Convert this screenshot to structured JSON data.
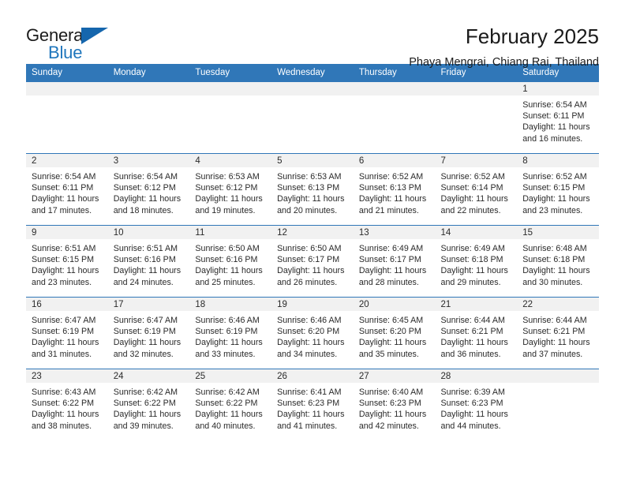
{
  "brand": {
    "name_top": "General",
    "name_bottom": "Blue",
    "triangle_color": "#1566ad",
    "blue_text_color": "#1f76bc"
  },
  "header": {
    "title": "February 2025",
    "subtitle": "Phaya Mengrai, Chiang Rai, Thailand",
    "header_bg": "#3077b8",
    "daynum_bg": "#f1f1f1"
  },
  "weekday_headers": [
    "Sunday",
    "Monday",
    "Tuesday",
    "Wednesday",
    "Thursday",
    "Friday",
    "Saturday"
  ],
  "labels": {
    "sunrise": "Sunrise:",
    "sunset": "Sunset:",
    "daylight": "Daylight:"
  },
  "weeks": [
    [
      {
        "day": "",
        "empty": true
      },
      {
        "day": "",
        "empty": true
      },
      {
        "day": "",
        "empty": true
      },
      {
        "day": "",
        "empty": true
      },
      {
        "day": "",
        "empty": true
      },
      {
        "day": "",
        "empty": true
      },
      {
        "day": "1",
        "sunrise": "Sunrise: 6:54 AM",
        "sunset": "Sunset: 6:11 PM",
        "daylight": "Daylight: 11 hours and 16 minutes."
      }
    ],
    [
      {
        "day": "2",
        "sunrise": "Sunrise: 6:54 AM",
        "sunset": "Sunset: 6:11 PM",
        "daylight": "Daylight: 11 hours and 17 minutes."
      },
      {
        "day": "3",
        "sunrise": "Sunrise: 6:54 AM",
        "sunset": "Sunset: 6:12 PM",
        "daylight": "Daylight: 11 hours and 18 minutes."
      },
      {
        "day": "4",
        "sunrise": "Sunrise: 6:53 AM",
        "sunset": "Sunset: 6:12 PM",
        "daylight": "Daylight: 11 hours and 19 minutes."
      },
      {
        "day": "5",
        "sunrise": "Sunrise: 6:53 AM",
        "sunset": "Sunset: 6:13 PM",
        "daylight": "Daylight: 11 hours and 20 minutes."
      },
      {
        "day": "6",
        "sunrise": "Sunrise: 6:52 AM",
        "sunset": "Sunset: 6:13 PM",
        "daylight": "Daylight: 11 hours and 21 minutes."
      },
      {
        "day": "7",
        "sunrise": "Sunrise: 6:52 AM",
        "sunset": "Sunset: 6:14 PM",
        "daylight": "Daylight: 11 hours and 22 minutes."
      },
      {
        "day": "8",
        "sunrise": "Sunrise: 6:52 AM",
        "sunset": "Sunset: 6:15 PM",
        "daylight": "Daylight: 11 hours and 23 minutes."
      }
    ],
    [
      {
        "day": "9",
        "sunrise": "Sunrise: 6:51 AM",
        "sunset": "Sunset: 6:15 PM",
        "daylight": "Daylight: 11 hours and 23 minutes."
      },
      {
        "day": "10",
        "sunrise": "Sunrise: 6:51 AM",
        "sunset": "Sunset: 6:16 PM",
        "daylight": "Daylight: 11 hours and 24 minutes."
      },
      {
        "day": "11",
        "sunrise": "Sunrise: 6:50 AM",
        "sunset": "Sunset: 6:16 PM",
        "daylight": "Daylight: 11 hours and 25 minutes."
      },
      {
        "day": "12",
        "sunrise": "Sunrise: 6:50 AM",
        "sunset": "Sunset: 6:17 PM",
        "daylight": "Daylight: 11 hours and 26 minutes."
      },
      {
        "day": "13",
        "sunrise": "Sunrise: 6:49 AM",
        "sunset": "Sunset: 6:17 PM",
        "daylight": "Daylight: 11 hours and 28 minutes."
      },
      {
        "day": "14",
        "sunrise": "Sunrise: 6:49 AM",
        "sunset": "Sunset: 6:18 PM",
        "daylight": "Daylight: 11 hours and 29 minutes."
      },
      {
        "day": "15",
        "sunrise": "Sunrise: 6:48 AM",
        "sunset": "Sunset: 6:18 PM",
        "daylight": "Daylight: 11 hours and 30 minutes."
      }
    ],
    [
      {
        "day": "16",
        "sunrise": "Sunrise: 6:47 AM",
        "sunset": "Sunset: 6:19 PM",
        "daylight": "Daylight: 11 hours and 31 minutes."
      },
      {
        "day": "17",
        "sunrise": "Sunrise: 6:47 AM",
        "sunset": "Sunset: 6:19 PM",
        "daylight": "Daylight: 11 hours and 32 minutes."
      },
      {
        "day": "18",
        "sunrise": "Sunrise: 6:46 AM",
        "sunset": "Sunset: 6:19 PM",
        "daylight": "Daylight: 11 hours and 33 minutes."
      },
      {
        "day": "19",
        "sunrise": "Sunrise: 6:46 AM",
        "sunset": "Sunset: 6:20 PM",
        "daylight": "Daylight: 11 hours and 34 minutes."
      },
      {
        "day": "20",
        "sunrise": "Sunrise: 6:45 AM",
        "sunset": "Sunset: 6:20 PM",
        "daylight": "Daylight: 11 hours and 35 minutes."
      },
      {
        "day": "21",
        "sunrise": "Sunrise: 6:44 AM",
        "sunset": "Sunset: 6:21 PM",
        "daylight": "Daylight: 11 hours and 36 minutes."
      },
      {
        "day": "22",
        "sunrise": "Sunrise: 6:44 AM",
        "sunset": "Sunset: 6:21 PM",
        "daylight": "Daylight: 11 hours and 37 minutes."
      }
    ],
    [
      {
        "day": "23",
        "sunrise": "Sunrise: 6:43 AM",
        "sunset": "Sunset: 6:22 PM",
        "daylight": "Daylight: 11 hours and 38 minutes."
      },
      {
        "day": "24",
        "sunrise": "Sunrise: 6:42 AM",
        "sunset": "Sunset: 6:22 PM",
        "daylight": "Daylight: 11 hours and 39 minutes."
      },
      {
        "day": "25",
        "sunrise": "Sunrise: 6:42 AM",
        "sunset": "Sunset: 6:22 PM",
        "daylight": "Daylight: 11 hours and 40 minutes."
      },
      {
        "day": "26",
        "sunrise": "Sunrise: 6:41 AM",
        "sunset": "Sunset: 6:23 PM",
        "daylight": "Daylight: 11 hours and 41 minutes."
      },
      {
        "day": "27",
        "sunrise": "Sunrise: 6:40 AM",
        "sunset": "Sunset: 6:23 PM",
        "daylight": "Daylight: 11 hours and 42 minutes."
      },
      {
        "day": "28",
        "sunrise": "Sunrise: 6:39 AM",
        "sunset": "Sunset: 6:23 PM",
        "daylight": "Daylight: 11 hours and 44 minutes."
      },
      {
        "day": "",
        "empty": true
      }
    ]
  ]
}
